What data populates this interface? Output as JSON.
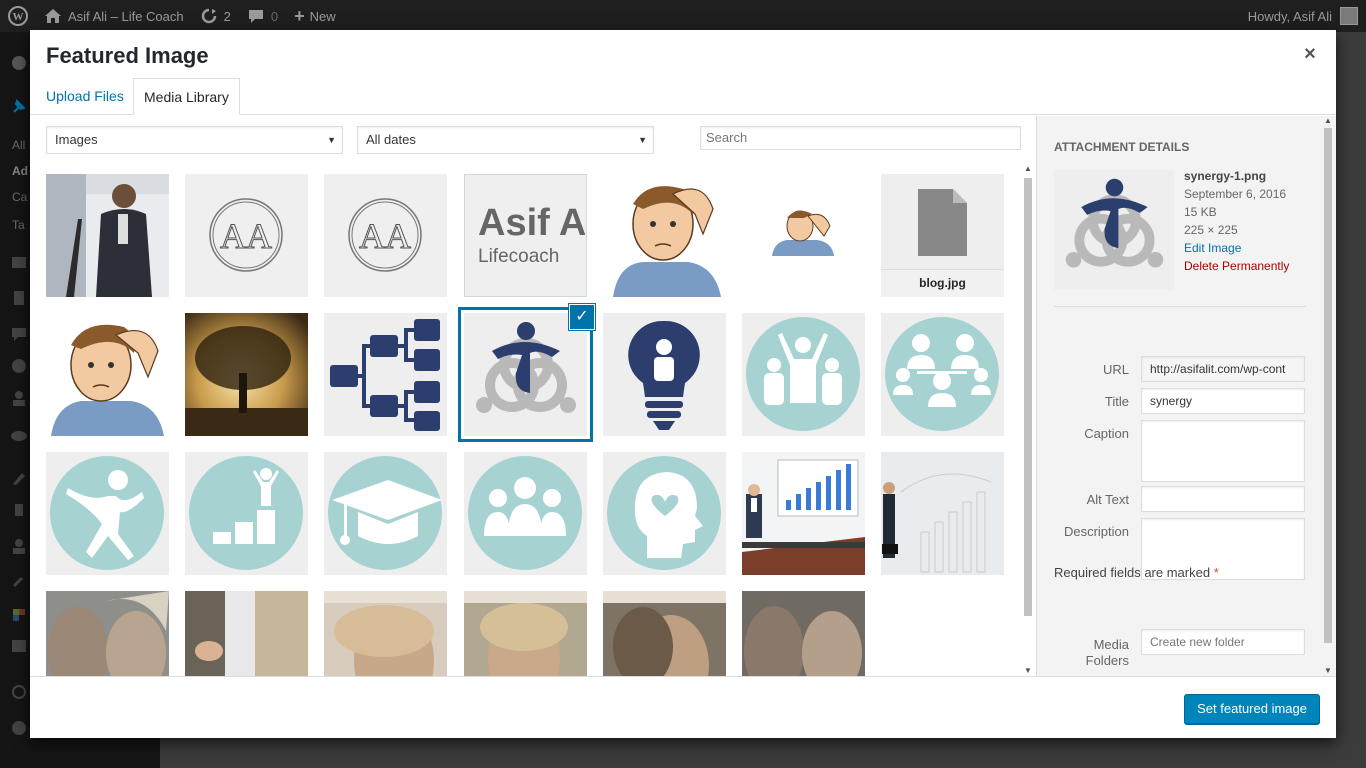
{
  "admin_bar": {
    "site_name": "Asif Ali – Life Coach",
    "updates_count": "2",
    "comments_count": "0",
    "new_label": "New",
    "howdy": "Howdy, Asif Ali"
  },
  "admin_menu": {
    "items": [
      "All",
      "Ad",
      "Ca",
      "Ta"
    ]
  },
  "modal": {
    "title": "Featured Image",
    "close_label": "×",
    "tabs": [
      {
        "label": "Upload Files",
        "active": false
      },
      {
        "label": "Media Library",
        "active": true
      }
    ]
  },
  "toolbar": {
    "type_filter": "Images",
    "date_filter": "All dates",
    "search_placeholder": "Search"
  },
  "attachments": [
    {
      "name": "speaker-photo"
    },
    {
      "name": "aa-logo-1"
    },
    {
      "name": "aa-logo-2"
    },
    {
      "name": "asif-lifecoach-text",
      "text1": "Asif A",
      "text2": "Lifecoach"
    },
    {
      "name": "confused-man-1"
    },
    {
      "name": "confused-man-small"
    },
    {
      "name": "blog-file",
      "filename": "blog.jpg"
    },
    {
      "name": "confused-man-2"
    },
    {
      "name": "tree-sunset"
    },
    {
      "name": "flowchart-icon"
    },
    {
      "name": "synergy-icon",
      "selected": true
    },
    {
      "name": "lightbulb-icon"
    },
    {
      "name": "group-cheer-icon"
    },
    {
      "name": "network-people-icon"
    },
    {
      "name": "jumping-person-icon"
    },
    {
      "name": "podium-icon"
    },
    {
      "name": "graduation-cap-icon"
    },
    {
      "name": "team-icon"
    },
    {
      "name": "head-heart-icon"
    },
    {
      "name": "office-chart-photo"
    },
    {
      "name": "businessman-chart-photo"
    },
    {
      "name": "couple-photo-1"
    },
    {
      "name": "handshake-photo"
    },
    {
      "name": "woman-smile-photo"
    },
    {
      "name": "couple-photo-2"
    },
    {
      "name": "woman-laugh-photo"
    },
    {
      "name": "couple-photo-3"
    }
  ],
  "details": {
    "heading": "Attachment Details",
    "filename": "synergy-1.png",
    "date": "September 6, 2016",
    "size": "15 KB",
    "dimensions": "225 × 225",
    "edit_label": "Edit Image",
    "delete_label": "Delete Permanently",
    "fields": {
      "url_label": "URL",
      "url_value": "http://asifalit.com/wp-cont",
      "title_label": "Title",
      "title_value": "synergy",
      "caption_label": "Caption",
      "caption_value": "",
      "alt_label": "Alt Text",
      "alt_value": "",
      "description_label": "Description",
      "description_value": "",
      "required_text": "Required fields are marked",
      "required_star": "*",
      "folders_label_1": "Media",
      "folders_label_2": "Folders",
      "folders_placeholder": "Create new folder"
    }
  },
  "footer": {
    "primary_button": "Set featured image"
  },
  "colors": {
    "accent": "#0073aa",
    "teal": "#a6d3d2",
    "navy": "#2c3e6e",
    "gray_logo": "#b7b7b7"
  }
}
